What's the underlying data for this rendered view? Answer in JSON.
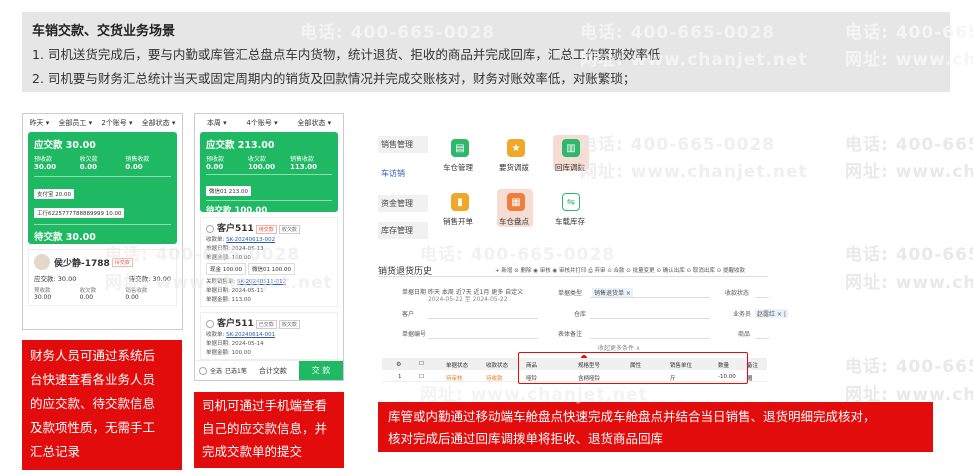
{
  "watermark": {
    "phone": "电话: 400-665-0028",
    "site": "网址: www.chanjet.net"
  },
  "banner": {
    "title": "车销交款、交货业务场景",
    "items": [
      "1.  司机送货完成后，要与内勤或库管汇总盘点车内货物，统计退货、拒收的商品并完成回库，汇总工作繁琐效率低",
      "2.  司机要与财务汇总统计当天或固定周期内的销货及回款情况并完成交账核对，财务对账效率低，对账繁琐；"
    ]
  },
  "phone1": {
    "filters": [
      "昨天 ▾",
      "全部员工 ▾",
      "2个账号 ▾",
      "全部状态 ▾"
    ],
    "card_title": "应交款 30.00",
    "stat_labels": [
      "预收款",
      "收欠款",
      "销售收款"
    ],
    "stat_values": [
      "30.00",
      "0.00",
      "0.00"
    ],
    "chips": [
      "支付宝 20.00",
      "工行6225777788889999 10.00"
    ],
    "pending": "待交款 30.00",
    "customer_name": "侯少静-1788",
    "customer_tag": "待交款",
    "due_label": "应交款: 30.00",
    "pending_label": "待交款: 30.00",
    "mini_labels": [
      "预收款",
      "收欠款",
      "销售收款"
    ],
    "mini_values": [
      "30.00",
      "0.00",
      "0.00"
    ]
  },
  "phone2": {
    "filters": [
      "本周 ▾",
      "4个账号 ▾",
      "全部状态 ▾"
    ],
    "card_title": "应交款 213.00",
    "stat_labels": [
      "预收款",
      "收欠款",
      "销售收款"
    ],
    "stat_values": [
      "0.00",
      "100.00",
      "113.00"
    ],
    "chip": "微信01 213.00",
    "pending": "待交款 100.00",
    "c1_name": "客户511",
    "c1_tags": [
      "待交款",
      "收欠款"
    ],
    "c1_doc_label": "收款单:",
    "c1_doc": "SK-20240613-002",
    "c1_date": "单据日期: 2024-05-13",
    "c1_amt": "单据金额: 100.00",
    "c1_chip1": "现金 100.00",
    "c1_chip2": "微信01 100.00",
    "c1_link_label": "关联销售单:",
    "c1_link": "SK-20240511-012",
    "c1_date2": "单据日期: 2024-05-11",
    "c1_amt2": "单据金额: 113.00",
    "c2_name": "客户511",
    "c2_tags": [
      "已交款",
      "收欠款"
    ],
    "c2_doc_label": "收款单:",
    "c2_doc": "SK-20240614-001",
    "c2_date": "单据日期: 2024-05-14",
    "c2_amt": "单据金额: 100.00",
    "footer_select": "全选",
    "footer_count": "已选1笔",
    "footer_total": "合计交款",
    "footer_btn": "交 款"
  },
  "captions": {
    "left": [
      "财务人员可通过系统后",
      "台快速查看各业务人员",
      "的应交款、待交款信息",
      "及款项性质，无需手工",
      "汇总记录"
    ],
    "middle": [
      "司机可通过手机端查看",
      "自己的应交款信息，并",
      "完成交款单的提交"
    ],
    "right": [
      "库管或内勤通过移动端车舱盘点快速完成车舱盘点并结合当日销售、退货明细完成核对，",
      "核对完成后通过回库调拨单将拒收、退货商品回库"
    ]
  },
  "desktop_menu": {
    "side": [
      "销售管理",
      "车访销",
      "资金管理",
      "库存管理"
    ],
    "apps": [
      "车仓管理",
      "要货调拨",
      "回库调拨",
      "销售开单",
      "车仓盘点",
      "车载库存"
    ]
  },
  "history": {
    "title": "销货退货历史",
    "toolbar": "+ 新增   ⊘ 删除   ◉ 审核   ◉ 审核并打印   ⎙ 弃审   ⊙ 合款   ⊙ 批量变更   ⊙ 确认出库   ⊙ 取消出库   ⊙ 提醒收款",
    "date_label": "单据日期",
    "date_opts": "昨天  本周  近7天  近1月  更多  自定义",
    "date_range": "2024-05-22 至 2024-05-22",
    "type_label": "单据类型",
    "type_value": "销售退货单 ×",
    "receipt_label": "收款状态",
    "customer_label": "客户",
    "warehouse_label": "仓库",
    "salesperson_label": "业务员",
    "salesperson_value": "赵露红 × |",
    "docno_label": "单据编号",
    "product_label": "商品",
    "memo_label": "表体备注",
    "expand": "收起更多条件 ∧",
    "columns": [
      "单据状态",
      "收款状态",
      "商品",
      "规格型号",
      "属性",
      "销售单位",
      "数量",
      "备注"
    ],
    "row": [
      "1",
      "待审核",
      "待收款",
      "哑铃",
      "含柄哑铃",
      "",
      "斤",
      "-10.00",
      "赠"
    ]
  }
}
